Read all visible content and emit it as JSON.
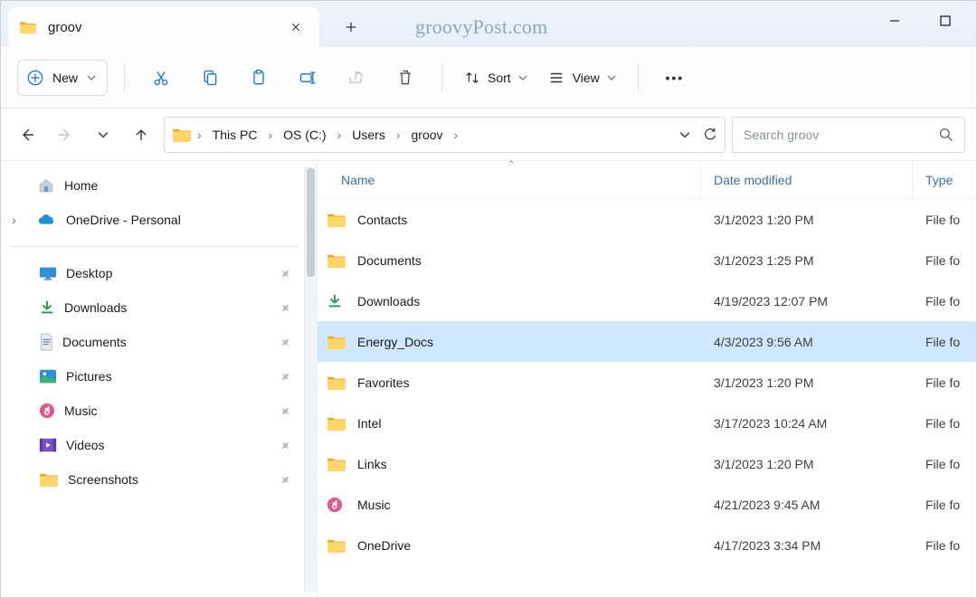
{
  "titlebar": {
    "tab_title": "groov",
    "watermark": "groovyPost.com"
  },
  "toolbar": {
    "new_label": "New",
    "sort_label": "Sort",
    "view_label": "View"
  },
  "address": {
    "segments": [
      "This PC",
      "OS (C:)",
      "Users",
      "groov"
    ]
  },
  "search": {
    "placeholder": "Search groov"
  },
  "columns": {
    "name": "Name",
    "date": "Date modified",
    "type": "Type"
  },
  "sidebar": {
    "home": "Home",
    "onedrive": "OneDrive - Personal",
    "quick": [
      {
        "label": "Desktop",
        "icon": "desktop"
      },
      {
        "label": "Downloads",
        "icon": "downloads"
      },
      {
        "label": "Documents",
        "icon": "documents"
      },
      {
        "label": "Pictures",
        "icon": "pictures"
      },
      {
        "label": "Music",
        "icon": "music"
      },
      {
        "label": "Videos",
        "icon": "videos"
      },
      {
        "label": "Screenshots",
        "icon": "folder"
      }
    ]
  },
  "files": [
    {
      "name": "Contacts",
      "date": "3/1/2023 1:20 PM",
      "type": "File fo",
      "icon": "folder",
      "selected": false
    },
    {
      "name": "Documents",
      "date": "3/1/2023 1:25 PM",
      "type": "File fo",
      "icon": "folder",
      "selected": false
    },
    {
      "name": "Downloads",
      "date": "4/19/2023 12:07 PM",
      "type": "File fo",
      "icon": "downloads",
      "selected": false
    },
    {
      "name": "Energy_Docs",
      "date": "4/3/2023 9:56 AM",
      "type": "File fo",
      "icon": "folder",
      "selected": true
    },
    {
      "name": "Favorites",
      "date": "3/1/2023 1:20 PM",
      "type": "File fo",
      "icon": "folder",
      "selected": false
    },
    {
      "name": "Intel",
      "date": "3/17/2023 10:24 AM",
      "type": "File fo",
      "icon": "folder",
      "selected": false
    },
    {
      "name": "Links",
      "date": "3/1/2023 1:20 PM",
      "type": "File fo",
      "icon": "folder",
      "selected": false
    },
    {
      "name": "Music",
      "date": "4/21/2023 9:45 AM",
      "type": "File fo",
      "icon": "music",
      "selected": false
    },
    {
      "name": "OneDrive",
      "date": "4/17/2023 3:34 PM",
      "type": "File fo",
      "icon": "folder",
      "selected": false
    }
  ]
}
